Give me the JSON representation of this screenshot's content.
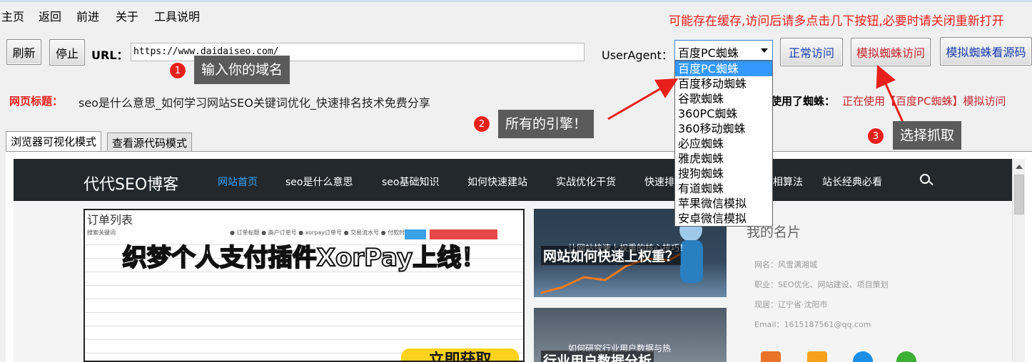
{
  "menu": [
    "主页",
    "返回",
    "前进",
    "关于",
    "工具说明"
  ],
  "notice": "可能存在缓存,访问后请多点击几下按钮,必要时请关闭重新打开",
  "toolbar": {
    "refresh": "刷新",
    "stop": "停止",
    "url_label": "URL：",
    "url_value": "https://www.daidaiseo.com/",
    "useragent_label": "UserAgent：",
    "useragent_selected": "百度PC蜘蛛",
    "normal_visit": "正常访问",
    "spider_visit": "模拟蜘蛛访问",
    "spider_source": "模拟蜘蛛看源码"
  },
  "useragent_options": [
    "百度PC蜘蛛",
    "百度移动蜘蛛",
    "谷歌蜘蛛",
    "360PC蜘蛛",
    "360移动蜘蛛",
    "必应蜘蛛",
    "雅虎蜘蛛",
    "搜狗蜘蛛",
    "有道蜘蛛",
    "苹果微信模拟",
    "安卓微信模拟"
  ],
  "page_title": {
    "label": "网页标题：",
    "value": "seo是什么意思_如何学习网站SEO关键词优化_快速排名技术免费分享"
  },
  "spider_status": {
    "label": "使用了蜘蛛：",
    "value": "正在使用【百度PC蜘蛛】模拟访问"
  },
  "tabs": [
    "浏览器可视化模式",
    "查看源代码模式"
  ],
  "site": {
    "logo": "代代SEO博客",
    "nav": [
      "网站首页",
      "seo是什么意思",
      "seo基础知识",
      "如何快速建站",
      "实战优化干货",
      "快速排",
      "相算法",
      "站长经典必看"
    ],
    "featured": {
      "title": "订单列表",
      "toolbar_text": "搜索关键词　　　　　　　　　　　　　　　　　　　　● 订单标题 ● 商户订单号 ● xorpay订单号 ● 交易流水号 ● 付款时间",
      "overlay": "织梦个人支付插件XorPay上线！",
      "sticker": "立即获取"
    },
    "card1": {
      "small": "让网站快速上权重的核心技巧！",
      "big": "网站如何快速上权重？"
    },
    "card2": {
      "small": "如何研究行业用户数据与热",
      "big": "行业用户数据分析"
    },
    "profile": {
      "title": "我的名片",
      "lines": [
        "网名：风雪满湘城",
        "职业：SEO优化、网站建设、项目策划",
        "现居：辽宁省·沈阳市",
        "Email：1615187561@qq.com"
      ]
    }
  },
  "callouts": [
    {
      "num": "1",
      "text": "输入你的域名"
    },
    {
      "num": "2",
      "text": "所有的引擎！"
    },
    {
      "num": "3",
      "text": "选择抓取"
    }
  ],
  "colors": {
    "accent_red": "#e8201c",
    "nav_bg": "#23282d",
    "nav_active": "#36a3f7",
    "dropdown_selected": "#3399ff",
    "callout_bg": "#5b5b5b"
  }
}
